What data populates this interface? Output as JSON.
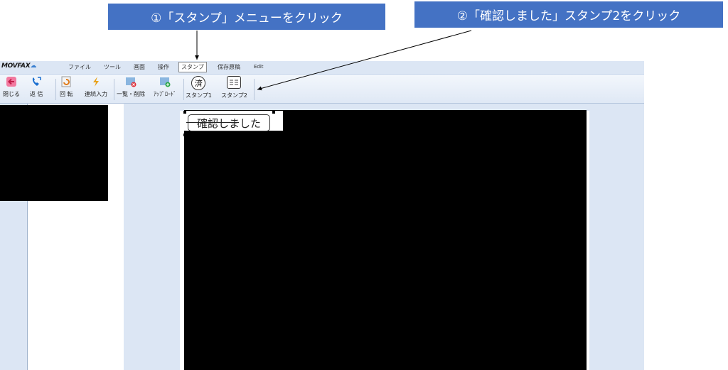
{
  "callouts": {
    "step1": "①「スタンプ」メニューをクリック",
    "step2": "②「確認しました」スタンプ2をクリック"
  },
  "app": {
    "logo": "MOVFAX",
    "menu": [
      "ファイル",
      "ツール",
      "画面",
      "操作",
      "スタンプ",
      "保存原稿",
      "Edit"
    ],
    "toolbar": {
      "close": "閉じる",
      "reply": "返 信",
      "rotate": "回 転",
      "continuous": "連続入力",
      "list_delete": "一覧・削除",
      "upload": "ｱｯﾌﾟﾛｰﾄﾞ",
      "stamp1": "スタンプ1",
      "stamp2": "スタンプ2",
      "stamp1_glyph": "済"
    },
    "stamp_text": "確認しました"
  },
  "colors": {
    "callout": "#4472c4",
    "toolbar_bg": "#dce6f4"
  },
  "icons": [
    "close-arrow-icon",
    "phone-reply-icon",
    "rotate-icon",
    "lightning-icon",
    "list-delete-icon",
    "upload-icon",
    "stamp-sumi-icon",
    "stamp-kakunin-icon"
  ]
}
